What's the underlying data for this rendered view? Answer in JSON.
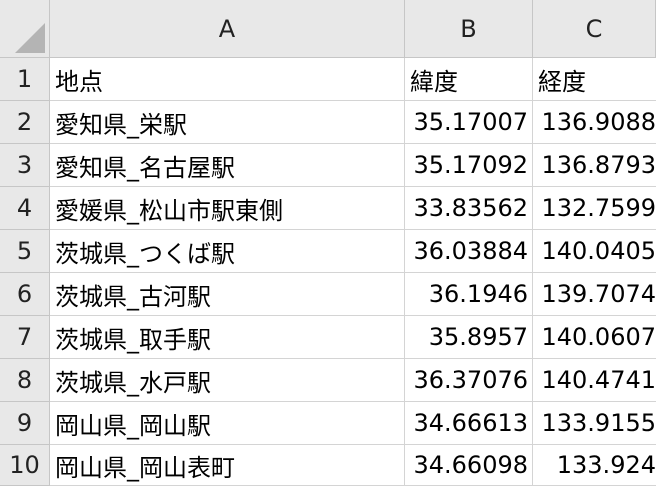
{
  "columns": [
    "A",
    "B",
    "C"
  ],
  "rows": [
    {
      "num": "1",
      "a": "地点",
      "b": "緯度",
      "c": "経度"
    },
    {
      "num": "2",
      "a": "愛知県_栄駅",
      "b": "35.17007",
      "c": "136.9088"
    },
    {
      "num": "3",
      "a": "愛知県_名古屋駅",
      "b": "35.17092",
      "c": "136.8793"
    },
    {
      "num": "4",
      "a": "愛媛県_松山市駅東側",
      "b": "33.83562",
      "c": "132.7599"
    },
    {
      "num": "5",
      "a": "茨城県_つくば駅",
      "b": "36.03884",
      "c": "140.0405"
    },
    {
      "num": "6",
      "a": "茨城県_古河駅",
      "b": "36.1946",
      "c": "139.7074"
    },
    {
      "num": "7",
      "a": "茨城県_取手駅",
      "b": "35.8957",
      "c": "140.0607"
    },
    {
      "num": "8",
      "a": "茨城県_水戸駅",
      "b": "36.37076",
      "c": "140.4741"
    },
    {
      "num": "9",
      "a": "岡山県_岡山駅",
      "b": "34.66613",
      "c": "133.9155"
    },
    {
      "num": "10",
      "a": "岡山県_岡山表町",
      "b": "34.66098",
      "c": "133.924"
    }
  ]
}
